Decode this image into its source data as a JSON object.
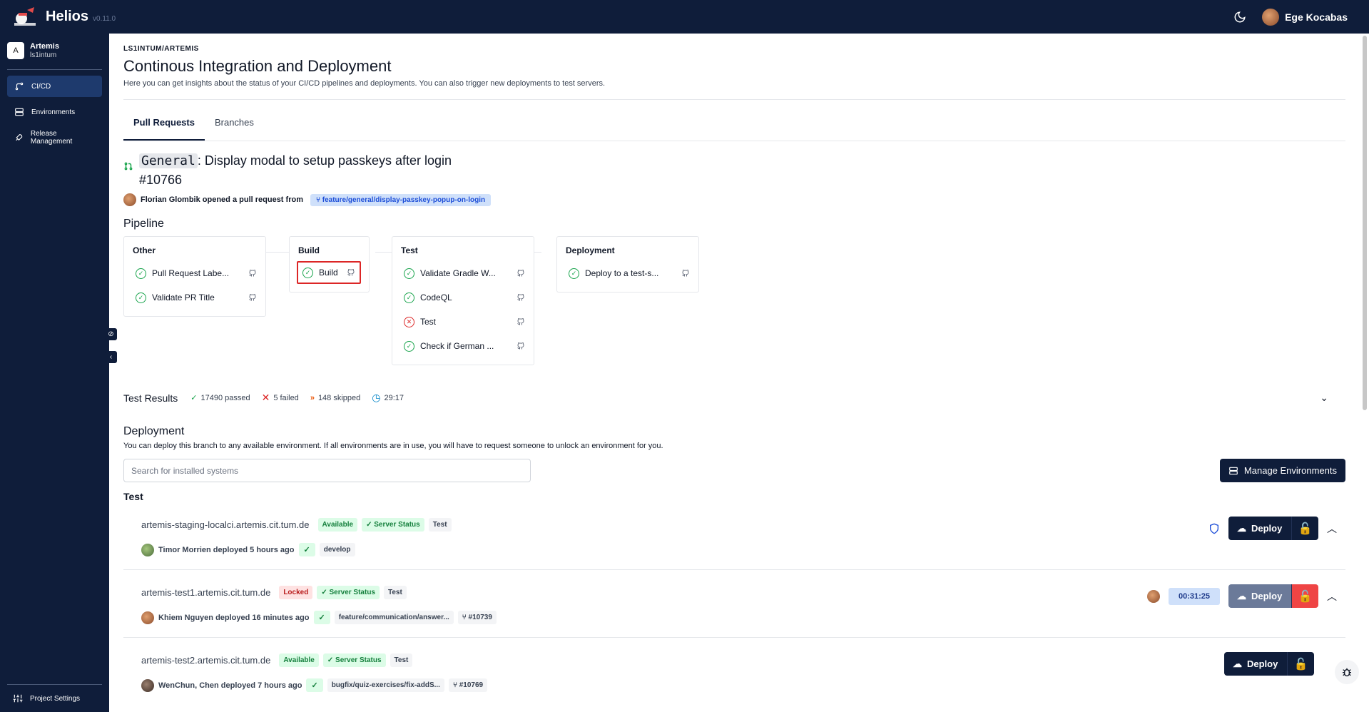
{
  "app": {
    "name": "Helios",
    "version": "v0.11.0"
  },
  "user": {
    "name": "Ege Kocabas"
  },
  "sidebar": {
    "project_initial": "A",
    "project_name": "Artemis",
    "project_org": "ls1intum",
    "items": [
      {
        "label": "CI/CD",
        "icon": "git-branch-icon",
        "active": true
      },
      {
        "label": "Environments",
        "icon": "server-icon",
        "active": false
      },
      {
        "label": "Release Management",
        "icon": "rocket-icon",
        "active": false
      }
    ],
    "settings_label": "Project Settings"
  },
  "page": {
    "breadcrumb": "LS1INTUM/ARTEMIS",
    "title": "Continous Integration and Deployment",
    "description": "Here you can get insights about the status of your CI/CD pipelines and deployments. You can also trigger new deployments to test servers."
  },
  "tabs": [
    "Pull Requests",
    "Branches"
  ],
  "pull_request": {
    "tag": "General",
    "title": ": Display modal to setup passkeys after login",
    "number": "#10766",
    "author_text": "Florian Glombik opened a pull request from",
    "branch": "feature/general/display-passkey-popup-on-login"
  },
  "pipeline": {
    "title": "Pipeline",
    "stages": [
      {
        "name": "Other",
        "jobs": [
          {
            "name": "Pull Request Labe...",
            "status": "success"
          },
          {
            "name": "Validate PR Title",
            "status": "success"
          }
        ]
      },
      {
        "name": "Build",
        "jobs": [
          {
            "name": "Build",
            "status": "success"
          }
        ]
      },
      {
        "name": "Test",
        "jobs": [
          {
            "name": "Validate Gradle W...",
            "status": "success"
          },
          {
            "name": "CodeQL",
            "status": "success"
          },
          {
            "name": "Test",
            "status": "failure"
          },
          {
            "name": "Check if German ...",
            "status": "success"
          }
        ]
      },
      {
        "name": "Deployment",
        "jobs": [
          {
            "name": "Deploy to a test-s...",
            "status": "success"
          }
        ]
      }
    ]
  },
  "test_results": {
    "title": "Test Results",
    "passed": "17490 passed",
    "failed": "5 failed",
    "skipped": "148 skipped",
    "duration": "29:17"
  },
  "deployment": {
    "title": "Deployment",
    "description": "You can deploy this branch to any available environment. If all environments are in use, you will have to request someone to unlock an environment for you.",
    "search_placeholder": "Search for installed systems",
    "manage_label": "Manage Environments",
    "group": "Test",
    "deploy_label": "Deploy",
    "environments": [
      {
        "name": "artemis-staging-localci.artemis.cit.tum.de",
        "status": "Available",
        "server_status": "Server Status",
        "type": "Test",
        "deployed_by": "Timor Morrien deployed 5 hours ago",
        "branch": "develop",
        "pr": ""
      },
      {
        "name": "artemis-test1.artemis.cit.tum.de",
        "status": "Locked",
        "server_status": "Server Status",
        "type": "Test",
        "deployed_by": "Khiem Nguyen deployed 16 minutes ago",
        "branch": "feature/communication/answer...",
        "pr": "#10739",
        "timer": "00:31:25"
      },
      {
        "name": "artemis-test2.artemis.cit.tum.de",
        "status": "Available",
        "server_status": "Server Status",
        "type": "Test",
        "deployed_by": "WenChun, Chen deployed 7 hours ago",
        "branch": "bugfix/quiz-exercises/fix-addS...",
        "pr": "#10769"
      }
    ]
  }
}
